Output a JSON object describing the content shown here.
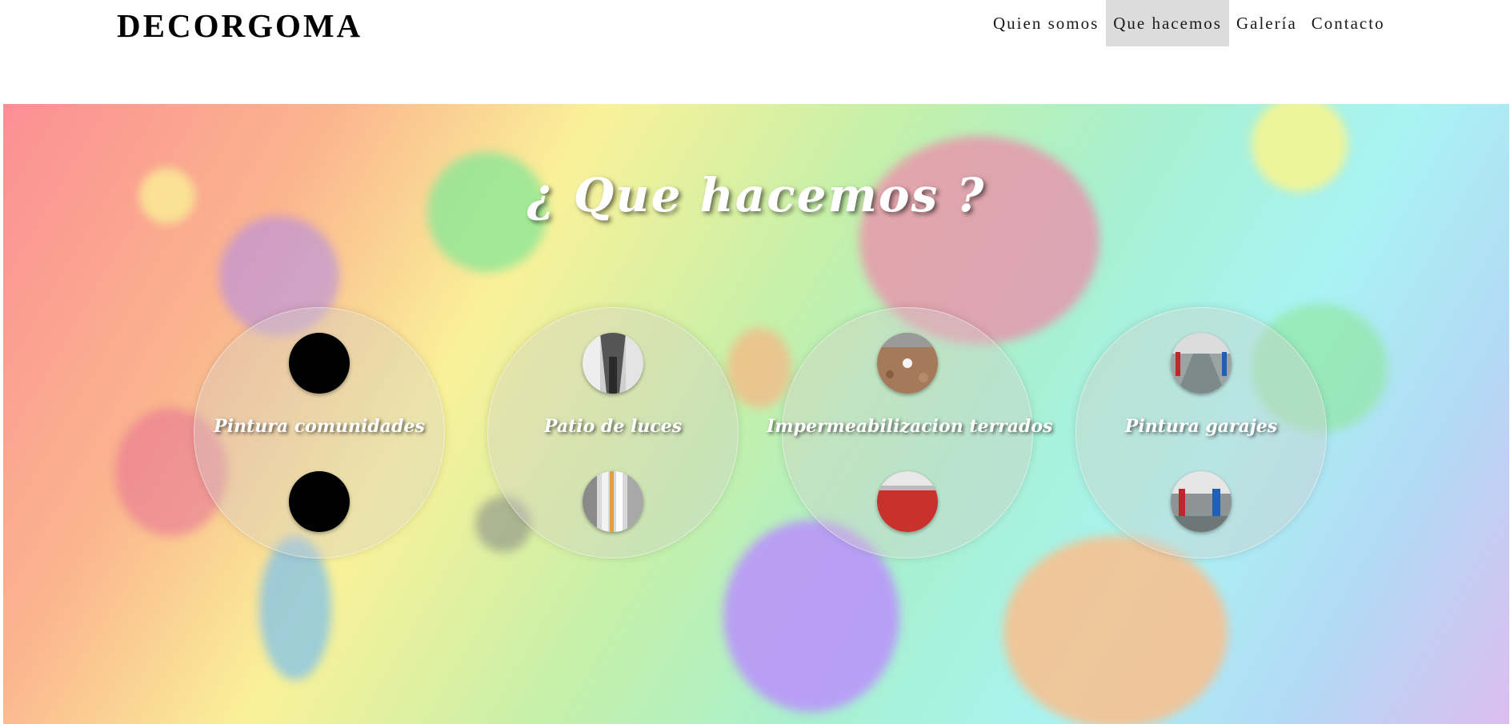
{
  "header": {
    "logo": "DECORGOMA",
    "nav": [
      {
        "label": "Quien somos",
        "active": false
      },
      {
        "label": "Que hacemos",
        "active": true
      },
      {
        "label": "Galería",
        "active": false
      },
      {
        "label": "Contacto",
        "active": false
      }
    ]
  },
  "hero": {
    "title": "¿ Que hacemos ?",
    "services": [
      {
        "label": "Pintura comunidades",
        "top_image": "black-placeholder",
        "bottom_image": "black-placeholder"
      },
      {
        "label": "Patio de luces",
        "top_image": "patio-photo",
        "bottom_image": "patio-pipes-photo"
      },
      {
        "label": "Impermeabilizacion terrados",
        "top_image": "terrace-photo",
        "bottom_image": "red-terrace-photo"
      },
      {
        "label": "Pintura garajes",
        "top_image": "garage-photo",
        "bottom_image": "garage-columns-photo"
      }
    ]
  },
  "colors": {
    "nav_active_bg": "#dcdcdc",
    "title_color": "#ffffff"
  }
}
